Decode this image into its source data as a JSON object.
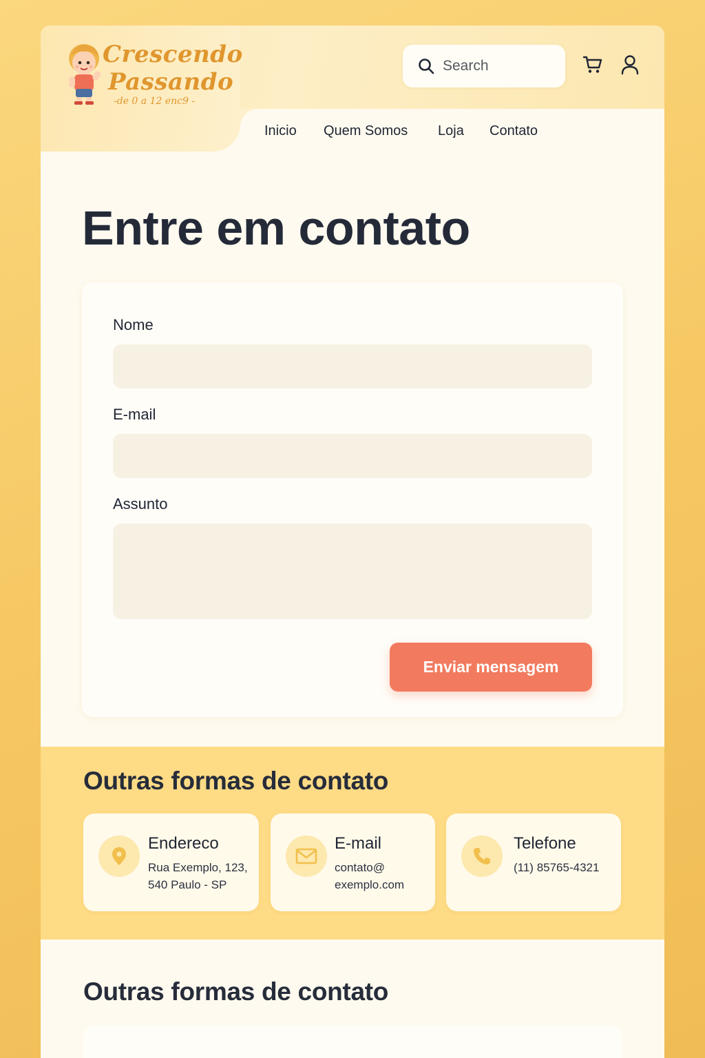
{
  "brand": {
    "line1": "Crescendo",
    "line2": "Passando",
    "tagline": "-de 0 a 12 enc9 -"
  },
  "search": {
    "placeholder": "Search"
  },
  "icons": {
    "search": "search-icon",
    "cart": "cart-icon",
    "user": "user-icon",
    "address": "location-pin-icon",
    "email": "envelope-icon",
    "phone": "phone-icon"
  },
  "nav": {
    "items": [
      {
        "label": "Inicio"
      },
      {
        "label": "Quem Somos"
      },
      {
        "label": "Loja"
      },
      {
        "label": "Contato"
      }
    ]
  },
  "main": {
    "title": "Entre em contato"
  },
  "form": {
    "name_label": "Nome",
    "name_value": "",
    "email_label": "E-mail",
    "email_value": "",
    "subject_label": "Assunto",
    "subject_value": "",
    "submit_label": "Enviar mensagem"
  },
  "other": {
    "title": "Outras formas de contato",
    "cards": [
      {
        "title": "Endereco",
        "text": "Rua Exemplo, 123,\n540 Paulo - SP"
      },
      {
        "title": "E-mail",
        "text": "contato@\nexemplo.com"
      },
      {
        "title": "Telefone",
        "text": "(11) 85765-4321"
      }
    ]
  },
  "second_section": {
    "title": "Outras formas de contato"
  },
  "colors": {
    "accent": "#f27a5e",
    "brand": "#e0962e",
    "band": "#fedb85",
    "background": "#f6c965"
  }
}
